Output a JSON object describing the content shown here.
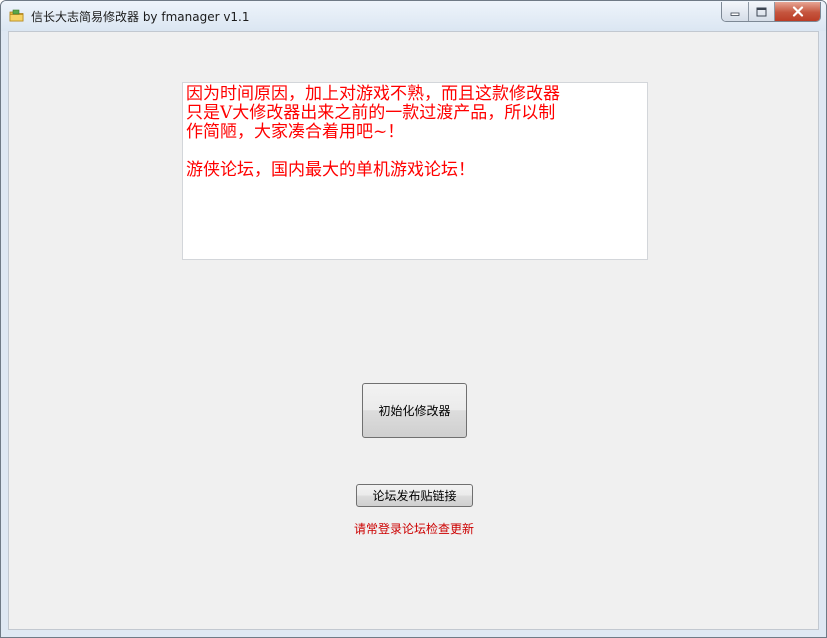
{
  "window": {
    "title": "信长大志简易修改器 by fmanager v1.1",
    "icon": "folder-icon"
  },
  "info_box": {
    "lines": [
      "因为时间原因，加上对游戏不熟，而且这款修改器",
      "只是V大修改器出来之前的一款过渡产品，所以制",
      "作简陋，大家凑合着用吧~！",
      "",
      "游侠论坛，国内最大的单机游戏论坛！"
    ],
    "text_color": "#ff0000"
  },
  "buttons": {
    "init_label": "初始化修改器",
    "forum_link_label": "论坛发布贴链接"
  },
  "notice": {
    "text": "请常登录论坛检查更新",
    "color": "#cc0000"
  }
}
